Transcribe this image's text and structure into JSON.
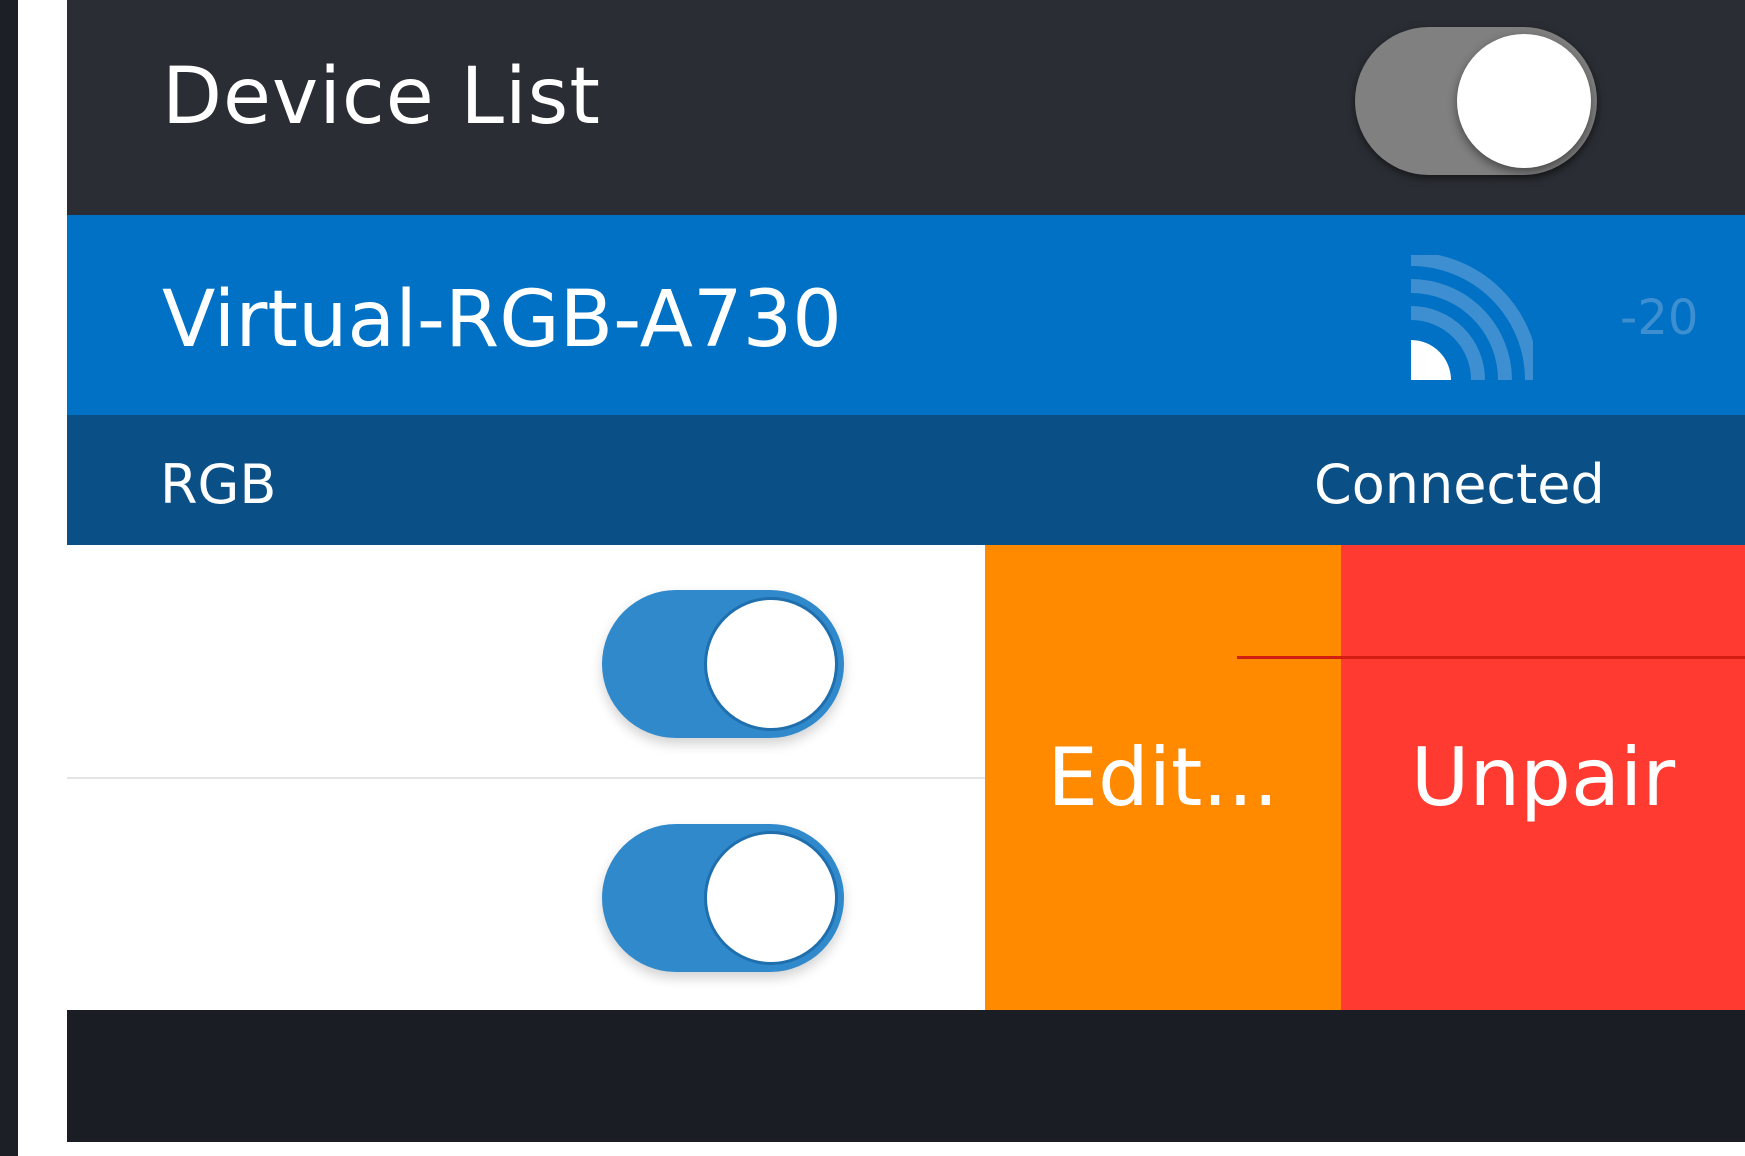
{
  "header": {
    "title": "Device List",
    "scan_toggle": {
      "on": true,
      "track_color": "#808080"
    }
  },
  "device": {
    "name": "Virtual-RGB-A730",
    "signal_icon": "signal-strength-icon",
    "rssi": "-20",
    "type": "RGB",
    "status": "Connected",
    "row_color": "#0071c4",
    "status_row_color": "#0b4f87"
  },
  "options": [
    {
      "on": true,
      "track_color": "#3089cb"
    },
    {
      "on": true,
      "track_color": "#3089cb"
    }
  ],
  "actions": {
    "edit_label": "Edit...",
    "edit_color": "#ff8a00",
    "unpair_label": "Unpair",
    "unpair_color": "#ff3a30"
  }
}
